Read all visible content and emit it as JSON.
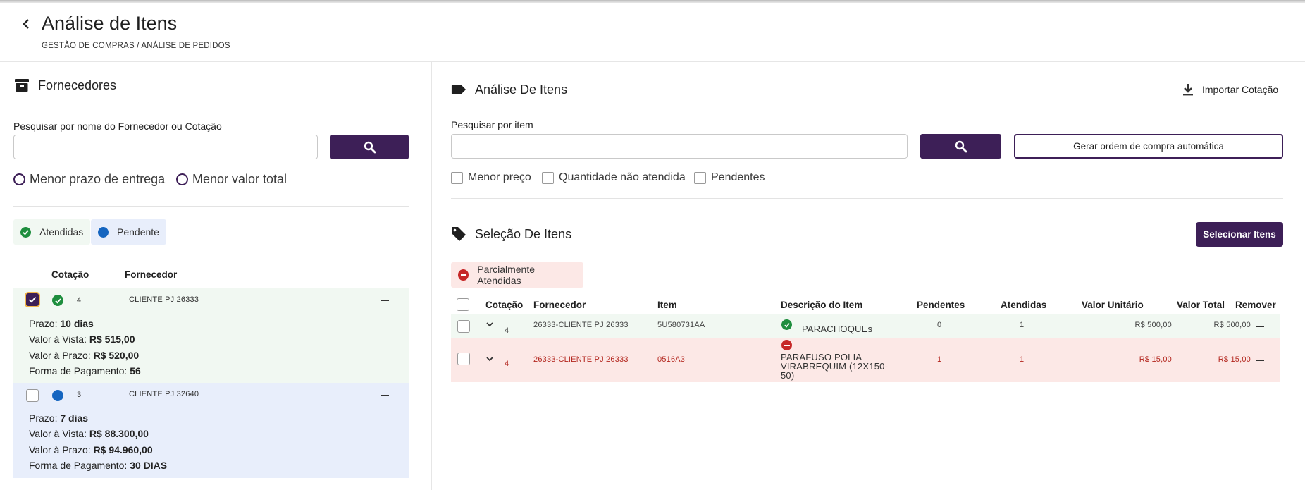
{
  "header": {
    "title": "Análise de Itens",
    "breadcrumb": "GESTÃO DE COMPRAS / ANÁLISE DE PEDIDOS"
  },
  "left": {
    "section_title": "Fornecedores",
    "search_label": "Pesquisar por nome do Fornecedor ou Cotação",
    "search_value": "",
    "radios": [
      "Menor prazo de entrega",
      "Menor valor total"
    ],
    "chips": {
      "attended": "Atendidas",
      "pending": "Pendente"
    },
    "columns": {
      "quote": "Cotação",
      "supplier": "Fornecedor"
    },
    "cards": [
      {
        "quote": "4",
        "supplier": "CLIENTE PJ 26333",
        "checked": true,
        "status": "attended",
        "prazo_label": "Prazo:",
        "prazo": "10 dias",
        "vista_label": "Valor à Vista:",
        "vista": "R$ 515,00",
        "aprazo_label": "Valor à Prazo:",
        "aprazo": "R$ 520,00",
        "pag_label": "Forma de Pagamento:",
        "pag": "56"
      },
      {
        "quote": "3",
        "supplier": "CLIENTE PJ 32640",
        "checked": false,
        "status": "pending",
        "prazo_label": "Prazo:",
        "prazo": "7 dias",
        "vista_label": "Valor à Vista:",
        "vista": "R$ 88.300,00",
        "aprazo_label": "Valor à Prazo:",
        "aprazo": "R$ 94.960,00",
        "pag_label": "Forma de Pagamento:",
        "pag": "30 DIAS"
      }
    ]
  },
  "right": {
    "analysis_title": "Análise De Itens",
    "import_label": "Importar Cotação",
    "search_label": "Pesquisar por item",
    "search_value": "",
    "auto_po_label": "Gerar ordem de compra automática",
    "filters": [
      "Menor preço",
      "Quantidade não atendida",
      "Pendentes"
    ],
    "selection_title": "Seleção De Itens",
    "select_items_label": "Selecionar Itens",
    "partial_chip": "Parcialmente Atendidas",
    "table": {
      "headers": [
        "Cotação",
        "Fornecedor",
        "Item",
        "Descrição do Item",
        "Pendentes",
        "Atendidas",
        "Valor Unitário",
        "Valor Total",
        "Remover"
      ],
      "rows": [
        {
          "quote": "4",
          "supplier": "26333-CLIENTE PJ 26333",
          "item": "5U580731AA",
          "desc": "PARACHOQUEs",
          "pending": "0",
          "attended": "1",
          "unit": "R$ 500,00",
          "total": "R$ 500,00",
          "status": "attended"
        },
        {
          "quote": "4",
          "supplier": "26333-CLIENTE PJ 26333",
          "item": "0516A3",
          "desc": "PARAFUSO POLIA VIRABREQUIM (12X150-50)",
          "pending": "1",
          "attended": "1",
          "unit": "R$ 15,00",
          "total": "R$ 15,00",
          "status": "partial"
        }
      ]
    }
  },
  "colors": {
    "primary": "#3d1f57",
    "success": "#1e8e3e",
    "pending_blue": "#1565c0",
    "danger": "#c62828",
    "green_bg": "#f1f8f2",
    "blue_bg": "#e8eefb",
    "red_bg": "#fce8e6"
  }
}
